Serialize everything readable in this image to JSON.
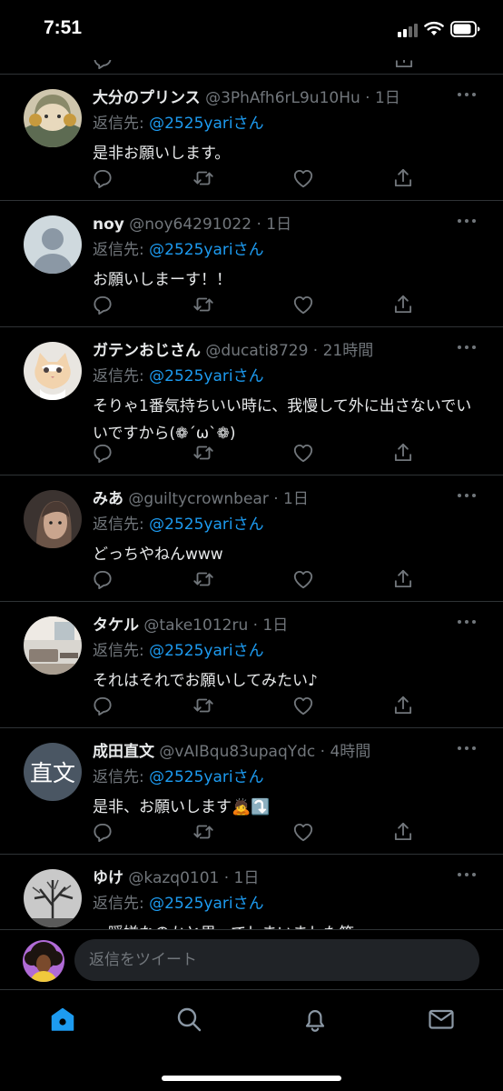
{
  "status_bar": {
    "time": "7:51"
  },
  "tweets": [
    {
      "name": "大分のプリンス",
      "meta": "@3PhAfh6rL9u10Hu · 1日",
      "reply_prefix": "返信先: ",
      "mention": "@2525yariさん",
      "text": "是非お願いします。"
    },
    {
      "name": "noy",
      "meta": "@noy64291022 · 1日",
      "reply_prefix": "返信先: ",
      "mention": "@2525yariさん",
      "text": "お願いしまーす！！"
    },
    {
      "name": "ガテンおじさん",
      "meta": "@ducati8729 · 21時間",
      "reply_prefix": "返信先: ",
      "mention": "@2525yariさん",
      "text": "そりゃ1番気持ちいい時に、我慢して外に出さないでいいですから(❁´ω`❁)"
    },
    {
      "name": "みあ",
      "meta": "@guiltycrownbear · 1日",
      "reply_prefix": "返信先: ",
      "mention": "@2525yariさん",
      "text": "どっちやねんwww"
    },
    {
      "name": "タケル",
      "meta": "@take1012ru · 1日",
      "reply_prefix": "返信先: ",
      "mention": "@2525yariさん",
      "text": "それはそれでお願いしてみたい♪"
    },
    {
      "name": "成田直文",
      "meta": "@vAIBqu83upaqYdc · 4時間",
      "reply_prefix": "返信先: ",
      "mention": "@2525yariさん",
      "text": "是非、お願いします🙇⤵️",
      "avatar_text": "直文"
    },
    {
      "name": "ゆけ",
      "meta": "@kazq0101 · 1日",
      "reply_prefix": "返信先: ",
      "mention": "@2525yariさん",
      "text": "一瞬嫌なのかと思ってしまいました笑"
    }
  ],
  "reply_composer": {
    "placeholder": "返信をツイート"
  },
  "tab_bar": {
    "items": [
      "home-icon",
      "search-icon",
      "notifications-icon",
      "messages-icon"
    ],
    "active": "home-icon"
  },
  "colors": {
    "background": "#000000",
    "accent": "#1d9bf0",
    "secondary_text": "#71767b",
    "divider": "#2f3336"
  }
}
